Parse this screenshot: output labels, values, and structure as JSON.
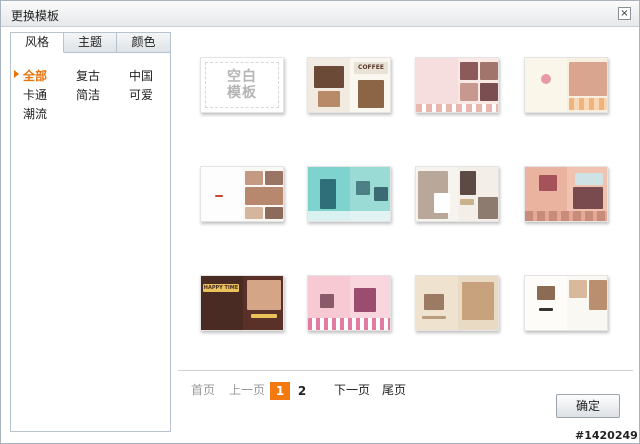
{
  "dialog": {
    "title": "更换模板",
    "close_glyph": "×"
  },
  "tabs": [
    {
      "label": "风格",
      "active": true
    },
    {
      "label": "主题",
      "active": false
    },
    {
      "label": "颜色",
      "active": false
    }
  ],
  "styles": [
    {
      "label": "全部",
      "selected": true
    },
    {
      "label": "复古",
      "selected": false
    },
    {
      "label": "中国",
      "selected": false
    },
    {
      "label": "卡通",
      "selected": false
    },
    {
      "label": "简洁",
      "selected": false
    },
    {
      "label": "可爱",
      "selected": false
    },
    {
      "label": "潮流",
      "selected": false
    }
  ],
  "templates": [
    {
      "kind": "blank",
      "text_line1": "空白",
      "text_line2": "模板"
    },
    {
      "kind": "photo",
      "theme": "coffee",
      "text": "COFFEE"
    },
    {
      "kind": "photo",
      "theme": "pink-kids"
    },
    {
      "kind": "photo",
      "theme": "kid-cream"
    },
    {
      "kind": "photo",
      "theme": "family-white"
    },
    {
      "kind": "photo",
      "theme": "teal-wave"
    },
    {
      "kind": "photo",
      "theme": "wedding"
    },
    {
      "kind": "photo",
      "theme": "salmon-baby"
    },
    {
      "kind": "photo",
      "theme": "brown-happy",
      "text": "HAPPY TIME"
    },
    {
      "kind": "photo",
      "theme": "pink-stripe"
    },
    {
      "kind": "photo",
      "theme": "beige-family"
    },
    {
      "kind": "photo",
      "theme": "white-baby"
    }
  ],
  "pager": {
    "first": "首页",
    "prev": "上一页",
    "pages": [
      "1",
      "2"
    ],
    "current_page": "1",
    "next": "下一页",
    "last": "尾页"
  },
  "confirm_label": "确定",
  "watermark": "#1420249",
  "colors": {
    "accent": "#f27a10",
    "selected_text": "#e8730c"
  }
}
